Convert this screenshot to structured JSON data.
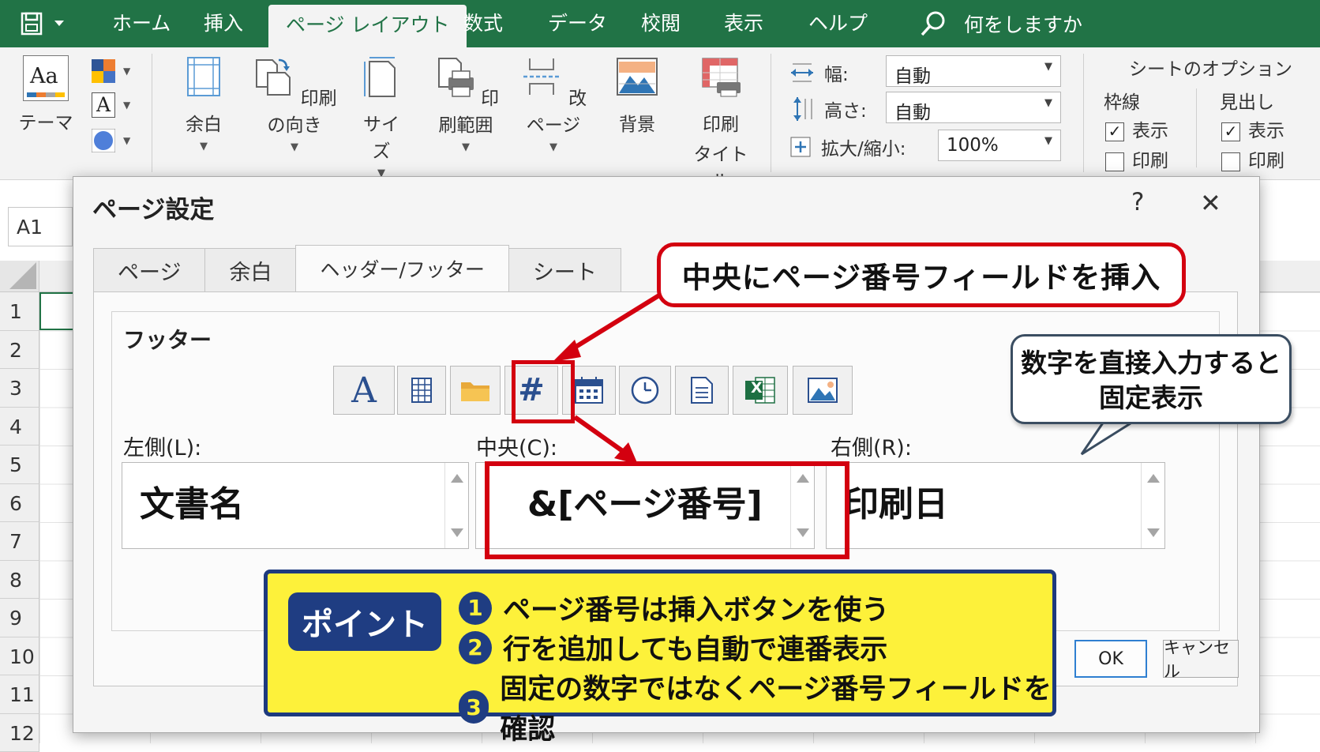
{
  "ribbon_tabs": [
    "ホーム",
    "挿入",
    "ページ レイアウト",
    "数式",
    "データ",
    "校閲",
    "表示",
    "ヘルプ"
  ],
  "tell_me": "何をしますか",
  "ribbon": {
    "theme": "テーマ",
    "theme_icon_text": "Aa",
    "font_icon_text": "A",
    "margins": "余白",
    "orientation": "印刷の向き",
    "size": "サイズ",
    "print_area": "印刷範囲",
    "breaks": "改ページ",
    "background": "背景",
    "print_titles_1": "印刷",
    "print_titles_2": "タイトル",
    "width_label": "幅:",
    "width_value": "自動",
    "height_label": "高さ:",
    "height_value": "自動",
    "scale_label": "拡大/縮小:",
    "scale_value": "100%",
    "sheet_options": "シートのオプション",
    "gridlines": "枠線",
    "headings": "見出し",
    "view": "表示",
    "print": "印刷"
  },
  "name_box": "A1",
  "rows": [
    "1",
    "2",
    "3",
    "4",
    "5",
    "6",
    "7",
    "8",
    "9",
    "10",
    "11",
    "12"
  ],
  "dialog": {
    "title": "ページ設定",
    "help": "?",
    "close": "✕",
    "tabs": [
      "ページ",
      "余白",
      "ヘッダー/フッター",
      "シート"
    ],
    "footer_label": "フッター",
    "left_label": "左側(L):",
    "left_value": "文書名",
    "center_label": "中央(C):",
    "center_value": "&[ページ番号]",
    "right_label": "右側(R):",
    "right_value": "印刷日",
    "ok": "OK",
    "cancel": "キャンセル",
    "toolbar_font_glyph": "A",
    "toolbar_pagenum_glyph": "#",
    "toolbar_excel_glyph": "X"
  },
  "callouts": {
    "top": "中央にページ番号フィールドを挿入",
    "right_line1": "数字を直接入力すると",
    "right_line2": "固定表示"
  },
  "point": {
    "tag": "ポイント",
    "items": [
      {
        "num": "1",
        "text": "ページ番号は挿入ボタンを使う"
      },
      {
        "num": "2",
        "text": "行を追加しても自動で連番表示"
      },
      {
        "num": "3",
        "text": "固定の数字ではなくページ番号フィールドを確認"
      }
    ]
  },
  "colors": {
    "excel_green": "#217346",
    "callout_red": "#d3000f",
    "point_yellow": "#fdf13a",
    "point_navy": "#1f3d82"
  }
}
